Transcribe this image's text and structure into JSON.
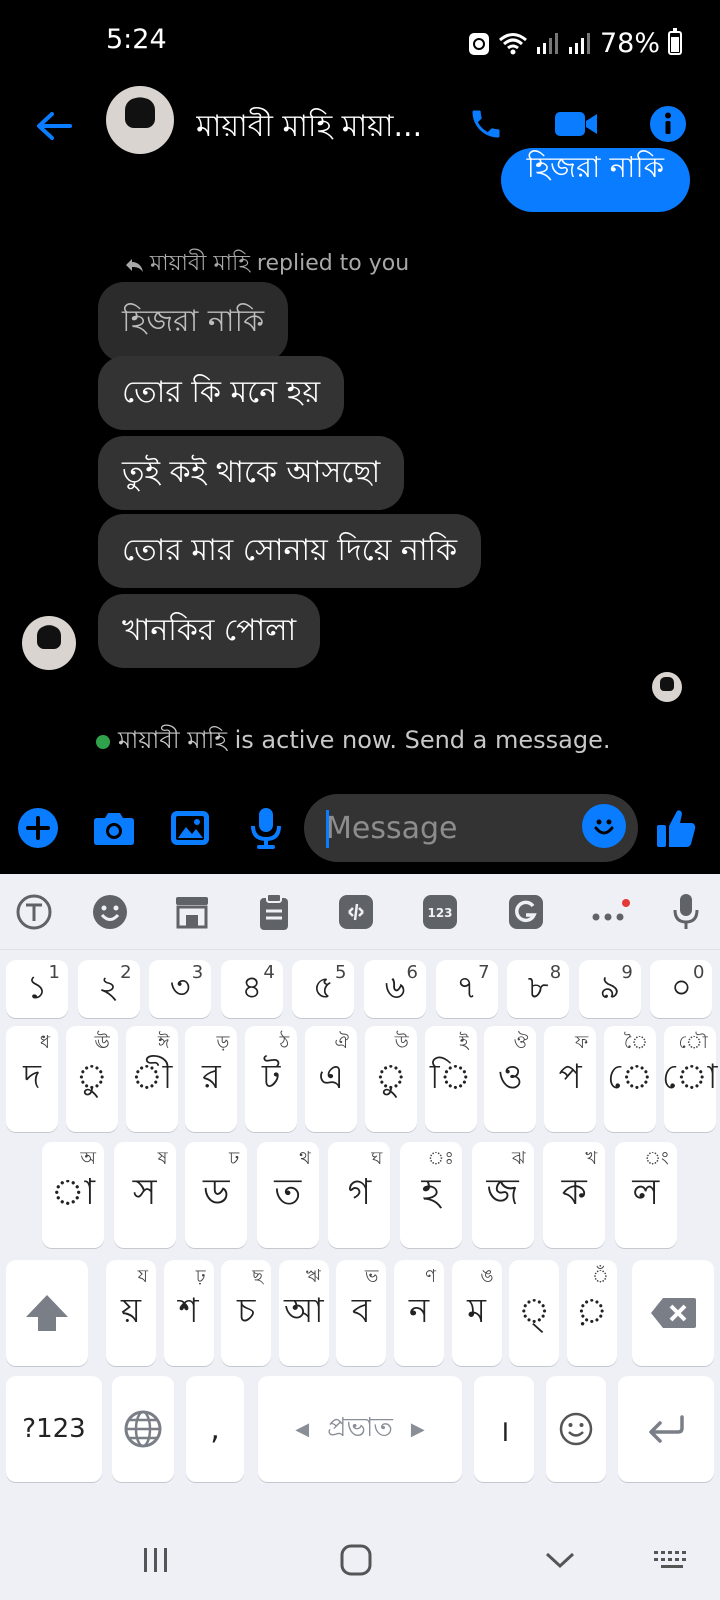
{
  "status_bar": {
    "time": "5:24",
    "battery_percent": "78%"
  },
  "header": {
    "contact_name": "মায়াবী মাহি মায়া..."
  },
  "messages": {
    "sent_partial": "হিজরা নাকি",
    "reply_label": "মায়াবী মাহি replied to you",
    "quoted_text": "হিজরা নাকি",
    "received": [
      "তোর কি মনে হয়",
      "তুই কই থাকে আসছো",
      "তোর মার সোনায় দিয়ে নাকি",
      "খানকির পোলা"
    ],
    "active_status": "মায়াবী মাহি is active now. Send a message."
  },
  "composer": {
    "placeholder": "Message"
  },
  "keyboard": {
    "number_row": [
      {
        "key": "১",
        "hint": "1"
      },
      {
        "key": "২",
        "hint": "2"
      },
      {
        "key": "৩",
        "hint": "3"
      },
      {
        "key": "৪",
        "hint": "4"
      },
      {
        "key": "৫",
        "hint": "5"
      },
      {
        "key": "৬",
        "hint": "6"
      },
      {
        "key": "৭",
        "hint": "7"
      },
      {
        "key": "৮",
        "hint": "8"
      },
      {
        "key": "৯",
        "hint": "9"
      },
      {
        "key": "০",
        "hint": "0"
      }
    ],
    "row1": [
      {
        "key": "দ",
        "hint": "ধ"
      },
      {
        "key": "ু",
        "hint": "ঊ"
      },
      {
        "key": "ী",
        "hint": "ঈ"
      },
      {
        "key": "র",
        "hint": "ড়"
      },
      {
        "key": "ট",
        "hint": "ঠ"
      },
      {
        "key": "এ",
        "hint": "ঐ"
      },
      {
        "key": "ু",
        "hint": "উ"
      },
      {
        "key": "ি",
        "hint": "ই"
      },
      {
        "key": "ও",
        "hint": "ঔ"
      },
      {
        "key": "প",
        "hint": "ফ"
      },
      {
        "key": "ে",
        "hint": "ৈ"
      },
      {
        "key": "ো",
        "hint": "ৌ"
      }
    ],
    "row2": [
      {
        "key": "া",
        "hint": "অ"
      },
      {
        "key": "স",
        "hint": "ষ"
      },
      {
        "key": "ড",
        "hint": "ঢ"
      },
      {
        "key": "ত",
        "hint": "থ"
      },
      {
        "key": "গ",
        "hint": "ঘ"
      },
      {
        "key": "হ",
        "hint": "ঃ"
      },
      {
        "key": "জ",
        "hint": "ঝ"
      },
      {
        "key": "ক",
        "hint": "খ"
      },
      {
        "key": "ল",
        "hint": "ং"
      }
    ],
    "row3": [
      {
        "key": "য়",
        "hint": "য"
      },
      {
        "key": "শ",
        "hint": "ঢ়"
      },
      {
        "key": "চ",
        "hint": "ছ"
      },
      {
        "key": "আ",
        "hint": "ঋ"
      },
      {
        "key": "ব",
        "hint": "ভ"
      },
      {
        "key": "ন",
        "hint": "ণ"
      },
      {
        "key": "ম",
        "hint": "ঙ"
      },
      {
        "key": "্",
        "hint": ""
      },
      {
        "key": "়",
        "hint": "ঁ"
      }
    ],
    "symbols_key": "?123",
    "comma_key": ",",
    "space_label": "প্রভাত",
    "danda_key": "।"
  },
  "colors": {
    "accent": "#0a7cff",
    "bubble": "#333333",
    "keyboard_bg": "#eef0f6"
  },
  "icons": [
    "back-arrow-icon",
    "phone-icon",
    "video-icon",
    "info-icon",
    "plus-icon",
    "camera-icon",
    "gallery-icon",
    "mic-icon",
    "emoji-icon",
    "like-icon",
    "shift-icon",
    "backspace-icon",
    "globe-icon",
    "enter-icon"
  ]
}
